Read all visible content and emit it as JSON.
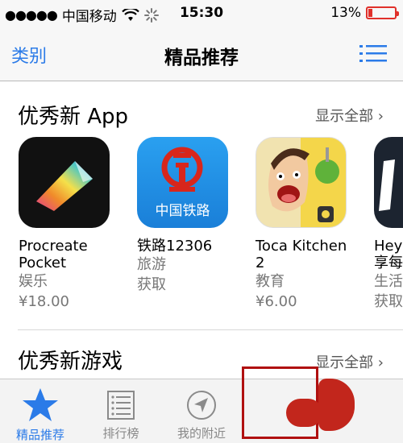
{
  "status": {
    "carrier": "中国移动",
    "time": "15:30",
    "battery": "13%",
    "battery_level": 0.13
  },
  "nav": {
    "left": "类别",
    "title": "精品推荐",
    "right_icon": "list-icon"
  },
  "section1": {
    "title": "优秀新 App",
    "see_all": "显示全部",
    "apps": [
      {
        "name": "Procreate Pocket",
        "name_lines": [
          "Procreate",
          "Pocket"
        ],
        "category": "娱乐",
        "price": "¥18.00",
        "icon": "procreate-icon"
      },
      {
        "name": "铁路12306",
        "name_lines": [
          "铁路12306"
        ],
        "category": "旅游",
        "price": "获取",
        "icon": "railway-icon",
        "icon_text": "中国铁路"
      },
      {
        "name": "Toca Kitchen 2",
        "name_lines": [
          "Toca Kitchen",
          "2"
        ],
        "category": "教育",
        "price": "¥6.00",
        "icon": "toca-icon"
      },
      {
        "name_lines": [
          "Heye",
          "享每"
        ],
        "category": "生活",
        "price": "获取",
        "icon": "partial-app-icon"
      }
    ]
  },
  "section2": {
    "title": "优秀新游戏",
    "see_all": "显示全部"
  },
  "tabbar": {
    "tabs": [
      {
        "label": "精品推荐",
        "icon": "star-icon",
        "active": true
      },
      {
        "label": "排行榜",
        "icon": "ranking-icon",
        "active": false
      },
      {
        "label": "我的附近",
        "icon": "location-icon",
        "active": false
      }
    ]
  },
  "colors": {
    "accent": "#2b7be8",
    "battery_low": "#e0302a",
    "highlight": "#b01010"
  }
}
